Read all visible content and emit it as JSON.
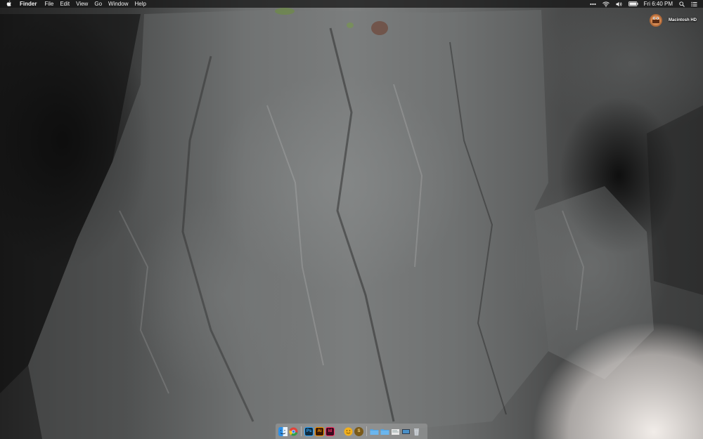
{
  "menubar": {
    "app_name": "Finder",
    "menus": [
      "File",
      "Edit",
      "View",
      "Go",
      "Window",
      "Help"
    ],
    "clock": "Fri 6:40 PM",
    "status_icons": [
      "more-dots-icon",
      "wifi-icon",
      "volume-icon",
      "battery-icon",
      "spotlight-icon",
      "notification-center-icon"
    ]
  },
  "desktop": {
    "drive_label": "Macintosh HD",
    "drive_icon": "hard-drive-icon"
  },
  "dock": {
    "apps": [
      {
        "name": "finder",
        "icon": "finder-icon",
        "label": "",
        "color": "#2c8fe6"
      },
      {
        "name": "chrome",
        "icon": "chrome-icon",
        "label": "",
        "color": "#e0443a"
      },
      {
        "name": "photoshop",
        "icon": "photoshop-icon",
        "label": "Ps",
        "color": "#0e2b40"
      },
      {
        "name": "illustrator",
        "icon": "illustrator-icon",
        "label": "Ai",
        "color": "#3a1a06"
      },
      {
        "name": "indesign",
        "icon": "indesign-icon",
        "label": "Id",
        "color": "#3b0a1f"
      },
      {
        "name": "emoji",
        "icon": "smiley-icon",
        "label": "",
        "color": "#f2b01d"
      },
      {
        "name": "s-app",
        "icon": "s-coin-icon",
        "label": "S",
        "color": "#7a5a1a"
      }
    ],
    "folders": [
      {
        "name": "applications-folder",
        "icon": "folder-icon",
        "color": "#4fa4e6"
      },
      {
        "name": "documents-folder",
        "icon": "folder-icon",
        "color": "#4fa4e6"
      },
      {
        "name": "downloads-stack",
        "icon": "document-stack-icon",
        "color": "#e8e8e8"
      },
      {
        "name": "screen-stack",
        "icon": "display-icon",
        "color": "#2d3a4a"
      },
      {
        "name": "trash",
        "icon": "trash-icon",
        "color": "#c8ccd0"
      }
    ]
  },
  "colors": {
    "menubar_bg": "#141414",
    "menubar_text": "#f2f2f2",
    "rock_dark": "#232323",
    "rock_light": "#7d7f7f",
    "surf": "#f5f0ec"
  }
}
